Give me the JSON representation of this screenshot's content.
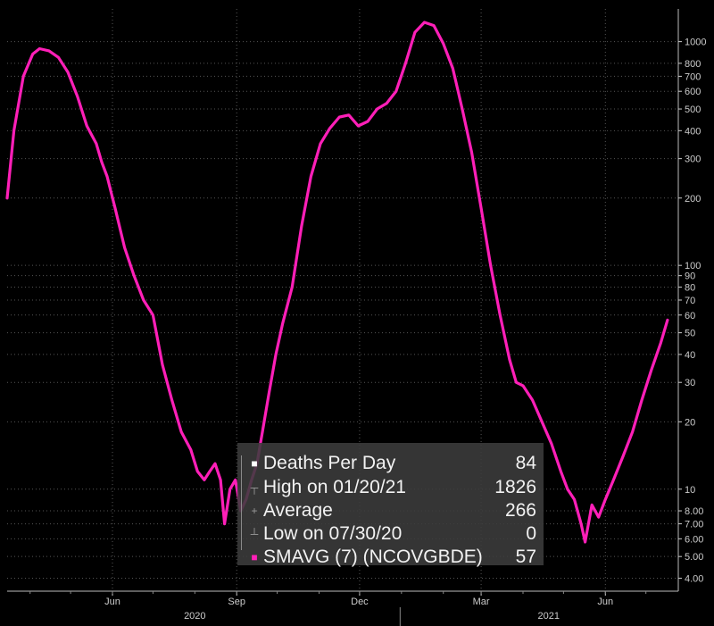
{
  "chart_data": {
    "type": "line",
    "y_scale": "log",
    "ylim": [
      3.5,
      1400
    ],
    "y_ticks": [
      4,
      5,
      6,
      7,
      8,
      10,
      20,
      30,
      40,
      50,
      60,
      70,
      80,
      90,
      100,
      200,
      300,
      400,
      500,
      600,
      700,
      800,
      1000
    ],
    "y_tick_labels": [
      "4.00",
      "5.00",
      "6.00",
      "7.00",
      "8.00",
      "10",
      "20",
      "30",
      "40",
      "50",
      "60",
      "70",
      "80",
      "90",
      "100",
      "200",
      "300",
      "400",
      "500",
      "600",
      "700",
      "800",
      "1000"
    ],
    "x_start": "2020-03-15",
    "x_end": "2021-07-25",
    "x_ticks": [
      {
        "date": "2020-06-01",
        "label": "Jun"
      },
      {
        "date": "2020-09-01",
        "label": "Sep"
      },
      {
        "date": "2020-12-01",
        "label": "Dec"
      },
      {
        "date": "2021-03-01",
        "label": "Mar"
      },
      {
        "date": "2021-06-01",
        "label": "Jun"
      }
    ],
    "x_year_labels": [
      {
        "date": "2020-08-01",
        "label": "2020"
      },
      {
        "date": "2021-04-20",
        "label": "2021"
      }
    ],
    "x_year_divider": "2020-12-31",
    "grid": true,
    "series": [
      {
        "name": "SMAVG (7) (NCOVGBDE)",
        "color": "#ff1fb8",
        "points": [
          [
            "2020-03-15",
            200
          ],
          [
            "2020-03-20",
            400
          ],
          [
            "2020-03-27",
            700
          ],
          [
            "2020-04-03",
            880
          ],
          [
            "2020-04-08",
            930
          ],
          [
            "2020-04-15",
            910
          ],
          [
            "2020-04-22",
            850
          ],
          [
            "2020-04-29",
            730
          ],
          [
            "2020-05-06",
            570
          ],
          [
            "2020-05-13",
            420
          ],
          [
            "2020-05-20",
            350
          ],
          [
            "2020-05-24",
            290
          ],
          [
            "2020-05-28",
            250
          ],
          [
            "2020-06-03",
            180
          ],
          [
            "2020-06-10",
            120
          ],
          [
            "2020-06-17",
            90
          ],
          [
            "2020-06-24",
            70
          ],
          [
            "2020-07-01",
            60
          ],
          [
            "2020-07-08",
            36
          ],
          [
            "2020-07-15",
            25
          ],
          [
            "2020-07-22",
            18
          ],
          [
            "2020-07-29",
            15
          ],
          [
            "2020-08-03",
            12
          ],
          [
            "2020-08-08",
            11
          ],
          [
            "2020-08-12",
            12
          ],
          [
            "2020-08-16",
            13
          ],
          [
            "2020-08-20",
            11
          ],
          [
            "2020-08-23",
            7
          ],
          [
            "2020-08-27",
            10
          ],
          [
            "2020-08-31",
            11
          ],
          [
            "2020-09-04",
            8
          ],
          [
            "2020-09-08",
            9
          ],
          [
            "2020-09-12",
            11
          ],
          [
            "2020-09-16",
            13
          ],
          [
            "2020-09-20",
            18
          ],
          [
            "2020-09-25",
            27
          ],
          [
            "2020-09-30",
            40
          ],
          [
            "2020-10-05",
            55
          ],
          [
            "2020-10-12",
            80
          ],
          [
            "2020-10-19",
            150
          ],
          [
            "2020-10-26",
            250
          ],
          [
            "2020-11-02",
            350
          ],
          [
            "2020-11-09",
            410
          ],
          [
            "2020-11-16",
            460
          ],
          [
            "2020-11-23",
            470
          ],
          [
            "2020-11-30",
            420
          ],
          [
            "2020-12-07",
            440
          ],
          [
            "2020-12-14",
            500
          ],
          [
            "2020-12-21",
            530
          ],
          [
            "2020-12-28",
            600
          ],
          [
            "2021-01-04",
            800
          ],
          [
            "2021-01-11",
            1100
          ],
          [
            "2021-01-18",
            1220
          ],
          [
            "2021-01-25",
            1180
          ],
          [
            "2021-02-01",
            980
          ],
          [
            "2021-02-08",
            760
          ],
          [
            "2021-02-15",
            500
          ],
          [
            "2021-02-22",
            320
          ],
          [
            "2021-03-01",
            180
          ],
          [
            "2021-03-08",
            100
          ],
          [
            "2021-03-15",
            60
          ],
          [
            "2021-03-22",
            38
          ],
          [
            "2021-03-27",
            30
          ],
          [
            "2021-04-01",
            29
          ],
          [
            "2021-04-08",
            25
          ],
          [
            "2021-04-15",
            20
          ],
          [
            "2021-04-22",
            16
          ],
          [
            "2021-04-29",
            12
          ],
          [
            "2021-05-04",
            10
          ],
          [
            "2021-05-09",
            9
          ],
          [
            "2021-05-14",
            7
          ],
          [
            "2021-05-17",
            5.8
          ],
          [
            "2021-05-22",
            8.5
          ],
          [
            "2021-05-27",
            7.5
          ],
          [
            "2021-06-01",
            9
          ],
          [
            "2021-06-07",
            11
          ],
          [
            "2021-06-14",
            14
          ],
          [
            "2021-06-21",
            18
          ],
          [
            "2021-06-28",
            25
          ],
          [
            "2021-07-05",
            34
          ],
          [
            "2021-07-12",
            45
          ],
          [
            "2021-07-17",
            57
          ]
        ]
      }
    ],
    "legend": [
      {
        "label": "Deaths Per Day",
        "value": "84",
        "marker": "■",
        "marker_color": "#ffffff"
      },
      {
        "label": "High on 01/20/21",
        "value": "1826",
        "marker": "┬",
        "marker_color": "#9a9a9a"
      },
      {
        "label": "Average",
        "value": "266",
        "marker": "+",
        "marker_color": "#9a9a9a"
      },
      {
        "label": "Low on 07/30/20",
        "value": "0",
        "marker": "┴",
        "marker_color": "#9a9a9a"
      },
      {
        "label": "SMAVG (7) (NCOVGBDE)",
        "value": "57",
        "marker": "■",
        "marker_color": "#ff1fb8"
      }
    ],
    "legend_placement": "bottom-center",
    "colors": {
      "background": "#000000",
      "grid": "#555555",
      "axis_text": "#cccccc",
      "line": "#ff1fb8"
    }
  }
}
